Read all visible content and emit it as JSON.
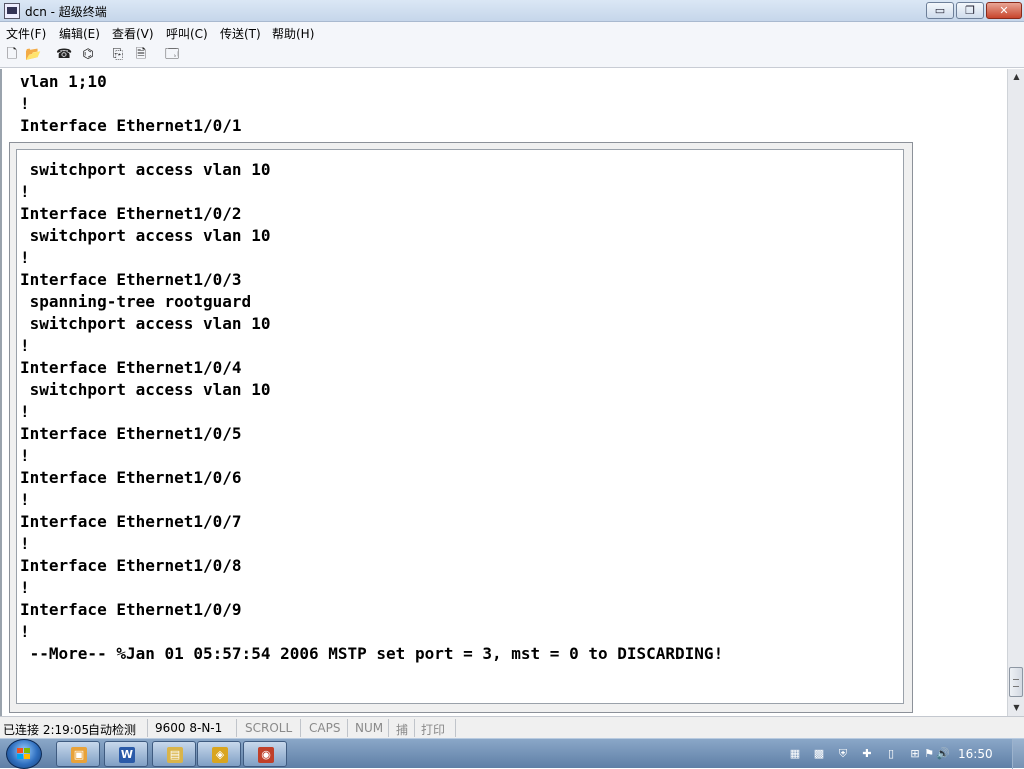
{
  "window": {
    "title": "dcn - 超级终端",
    "minimize_glyph": "▭",
    "maximize_glyph": "❐",
    "close_glyph": "✕"
  },
  "menu": {
    "items": [
      "文件(F)",
      "编辑(E)",
      "查看(V)",
      "呼叫(C)",
      "传送(T)",
      "帮助(H)"
    ]
  },
  "toolbar": {
    "icons": [
      {
        "name": "new-icon",
        "glyph": "🗋"
      },
      {
        "name": "open-icon",
        "glyph": "📂"
      },
      {
        "name": "call-icon",
        "glyph": "☎"
      },
      {
        "name": "disconnect-icon",
        "glyph": "⌬"
      },
      {
        "name": "send-icon",
        "glyph": "⎘"
      },
      {
        "name": "receive-icon",
        "glyph": "🗎"
      },
      {
        "name": "properties-icon",
        "glyph": "🗔"
      }
    ]
  },
  "terminal": {
    "lines": [
      "vlan 1;10",
      "!",
      "Interface Ethernet1/0/1",
      "",
      " switchport access vlan 10",
      "!",
      "Interface Ethernet1/0/2",
      " switchport access vlan 10",
      "!",
      "Interface Ethernet1/0/3",
      " spanning-tree rootguard",
      " switchport access vlan 10",
      "!",
      "Interface Ethernet1/0/4",
      " switchport access vlan 10",
      "!",
      "Interface Ethernet1/0/5",
      "!",
      "Interface Ethernet1/0/6",
      "!",
      "Interface Ethernet1/0/7",
      "!",
      "Interface Ethernet1/0/8",
      "!",
      "Interface Ethernet1/0/9",
      "!",
      " --More-- %Jan 01 05:57:54 2006 MSTP set port = 3, mst = 0 to DISCARDING!"
    ]
  },
  "statusbar": {
    "connected": "已连接 2:19:05",
    "detect": "自动检测",
    "baud": "9600 8-N-1",
    "scroll": "SCROLL",
    "caps": "CAPS",
    "num": "NUM",
    "capture": "捕",
    "print": "打印"
  },
  "taskbar": {
    "buttons": [
      {
        "name": "taskbar-folder-app",
        "glyph": "▣",
        "color": "#e8a23a"
      },
      {
        "name": "taskbar-word-app",
        "glyph": "W",
        "color": "#2a5aa8"
      },
      {
        "name": "taskbar-explorer-app",
        "glyph": "▤",
        "color": "#d9b44a"
      },
      {
        "name": "taskbar-database-app",
        "glyph": "◈",
        "color": "#d9a520"
      },
      {
        "name": "taskbar-terminal-app",
        "glyph": "◉",
        "color": "#c0402a"
      }
    ],
    "tray": [
      {
        "name": "network-red-icon",
        "glyph": "▦"
      },
      {
        "name": "green-status-icon",
        "glyph": "▩"
      },
      {
        "name": "shield-icon",
        "glyph": "⛨"
      },
      {
        "name": "security-icon",
        "glyph": "✚"
      },
      {
        "name": "clipboard-icon",
        "glyph": "▯"
      },
      {
        "name": "network-icon",
        "glyph": "⊞"
      },
      {
        "name": "flag-icon",
        "glyph": "⚑"
      },
      {
        "name": "volume-icon",
        "glyph": "🔊"
      }
    ],
    "clock": "16:50"
  }
}
